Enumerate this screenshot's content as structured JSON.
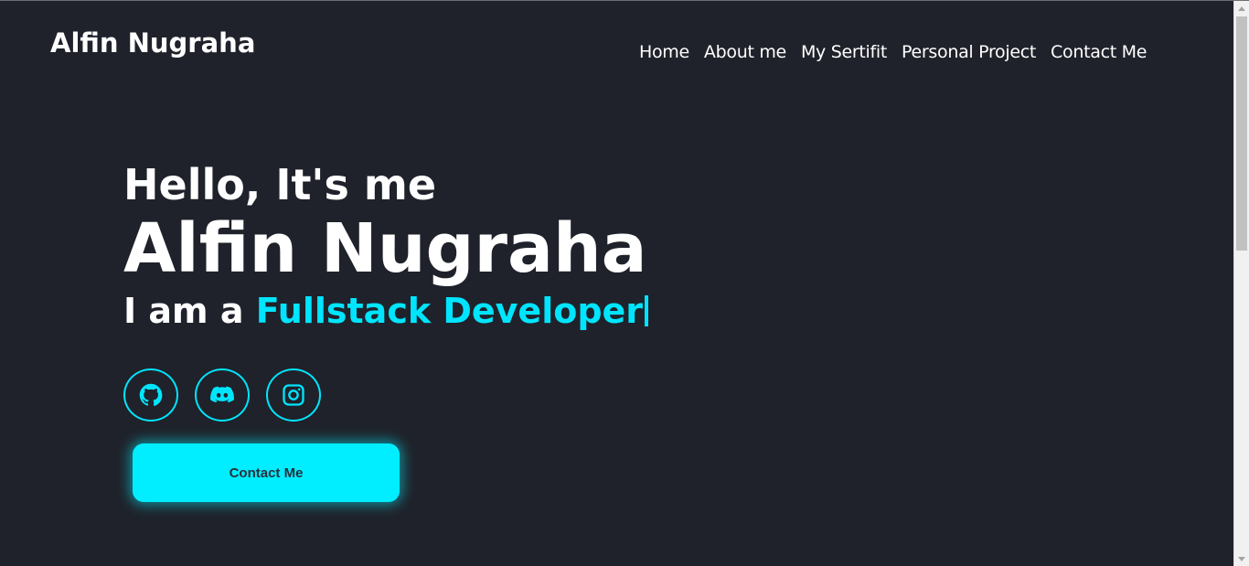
{
  "header": {
    "logo": "Alfin Nugraha",
    "nav": [
      {
        "label": "Home"
      },
      {
        "label": "About me"
      },
      {
        "label": "My Sertifit"
      },
      {
        "label": "Personal Project"
      },
      {
        "label": "Contact Me"
      }
    ]
  },
  "hero": {
    "greeting": "Hello, It's me",
    "name": "Alfin Nugraha",
    "role_prefix": "I am a ",
    "role_highlight": "Fullstack Developer"
  },
  "socials": [
    {
      "icon": "github-icon"
    },
    {
      "icon": "discord-icon"
    },
    {
      "icon": "instagram-icon"
    }
  ],
  "cta": {
    "label": "Contact Me"
  },
  "colors": {
    "background": "#1f222a",
    "accent": "#00e5ff",
    "text": "#ffffff"
  }
}
